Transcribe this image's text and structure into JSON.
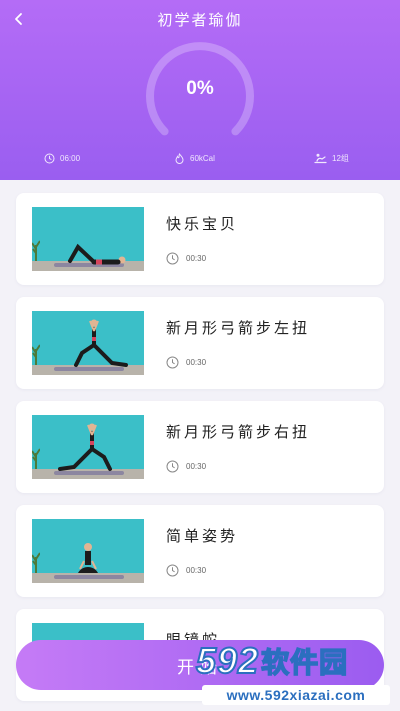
{
  "header": {
    "title": "初学者瑜伽",
    "progress_text": "0%",
    "progress": 0,
    "stats": {
      "time": "06:00",
      "time_icon": "clock-icon",
      "calories": "60kCal",
      "calories_icon": "flame-icon",
      "sets": "12组",
      "sets_icon": "stretch-icon"
    }
  },
  "exercises": [
    {
      "name": "快乐宝贝",
      "duration": "00:30",
      "pose": "lying"
    },
    {
      "name": "新月形弓箭步左扭",
      "duration": "00:30",
      "pose": "lunge"
    },
    {
      "name": "新月形弓箭步右扭",
      "duration": "00:30",
      "pose": "lunge"
    },
    {
      "name": "简单姿势",
      "duration": "00:30",
      "pose": "seated"
    },
    {
      "name": "眼镜蛇",
      "duration": "",
      "pose": "cobra"
    }
  ],
  "start_button_label": "开始",
  "watermark": {
    "brand_number": "592",
    "brand_text": "软件园",
    "url": "www.592xiazai.com"
  },
  "colors": {
    "accent": "#a363f3",
    "background": "#f3f2f8",
    "thumb_wall": "#3bbfc8"
  }
}
